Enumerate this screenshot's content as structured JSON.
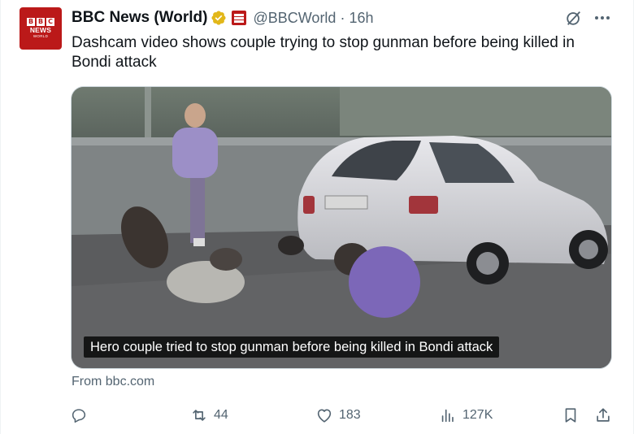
{
  "author": {
    "display_name": "BBC News (World)",
    "handle": "@BBCWorld",
    "separator": "·",
    "time": "16h",
    "avatar_text": {
      "blocks": [
        "B",
        "B",
        "C"
      ],
      "line1": "NEWS",
      "line2": "WORLD"
    },
    "verified_color": "#e2b719",
    "brand_color": "#bb1919"
  },
  "tweet": {
    "text": "Dashcam video shows couple trying to stop gunman before being killed in Bondi attack"
  },
  "media": {
    "caption": "Hero couple tried to stop gunman before being killed in Bondi attack",
    "source": "From bbc.com"
  },
  "actions": {
    "replies": "",
    "reposts": "44",
    "likes": "183",
    "views": "127K"
  },
  "icons": {
    "grok": "grok-icon",
    "more": "more-icon",
    "reply": "reply-icon",
    "repost": "repost-icon",
    "like": "heart-icon",
    "views": "views-icon",
    "bookmark": "bookmark-icon",
    "share": "share-icon"
  }
}
